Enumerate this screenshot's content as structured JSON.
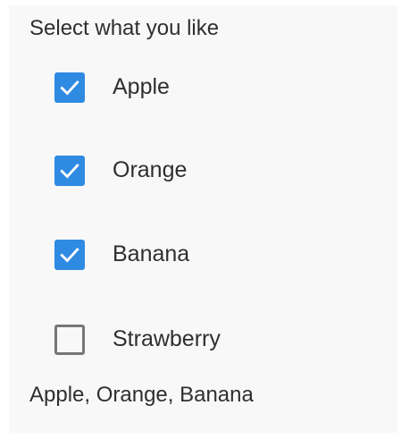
{
  "prompt": "Select what you like",
  "options": [
    {
      "label": "Apple",
      "checked": true
    },
    {
      "label": "Orange",
      "checked": true
    },
    {
      "label": "Banana",
      "checked": true
    },
    {
      "label": "Strawberry",
      "checked": false
    }
  ],
  "selection_summary": "Apple, Orange, Banana",
  "colors": {
    "checked_fill": "#2f8ae2",
    "unchecked_border": "#767676",
    "text": "#2f2f2f",
    "panel_background": "#f8f8f8"
  }
}
